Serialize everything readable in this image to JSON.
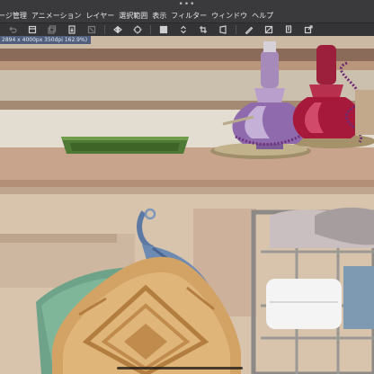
{
  "window": {
    "grab_dots": "•••"
  },
  "menu": {
    "items": [
      "ージ管理",
      "アニメーション",
      "レイヤー",
      "選択範囲",
      "表示",
      "フィルター",
      "ウィンドウ",
      "ヘルプ"
    ]
  },
  "toolbar": {
    "buttons": [
      {
        "icon": "undo-icon"
      },
      {
        "icon": "page-icon"
      },
      {
        "icon": "page-stack-icon"
      },
      {
        "icon": "export-icon"
      },
      {
        "icon": "clear-icon"
      },
      {
        "icon": "flip-horizontal-icon"
      },
      {
        "icon": "rotate-icon"
      },
      {
        "icon": "layer-fill-icon"
      },
      {
        "icon": "stepper-icon"
      },
      {
        "icon": "crop-icon"
      },
      {
        "icon": "transform-icon"
      },
      {
        "icon": "pen-icon"
      },
      {
        "icon": "ruler-icon"
      },
      {
        "icon": "copy-icon"
      },
      {
        "icon": "export-arrow-icon"
      }
    ]
  },
  "canvas": {
    "size_label": "2894 x 4000px 350dpi 162.9%)"
  },
  "colors": {
    "chrome_bg": "#3a3a3c",
    "size_tab": "#4f5f7d",
    "shelf_top": "#c9a48c",
    "wall": "#d8c3ad"
  }
}
